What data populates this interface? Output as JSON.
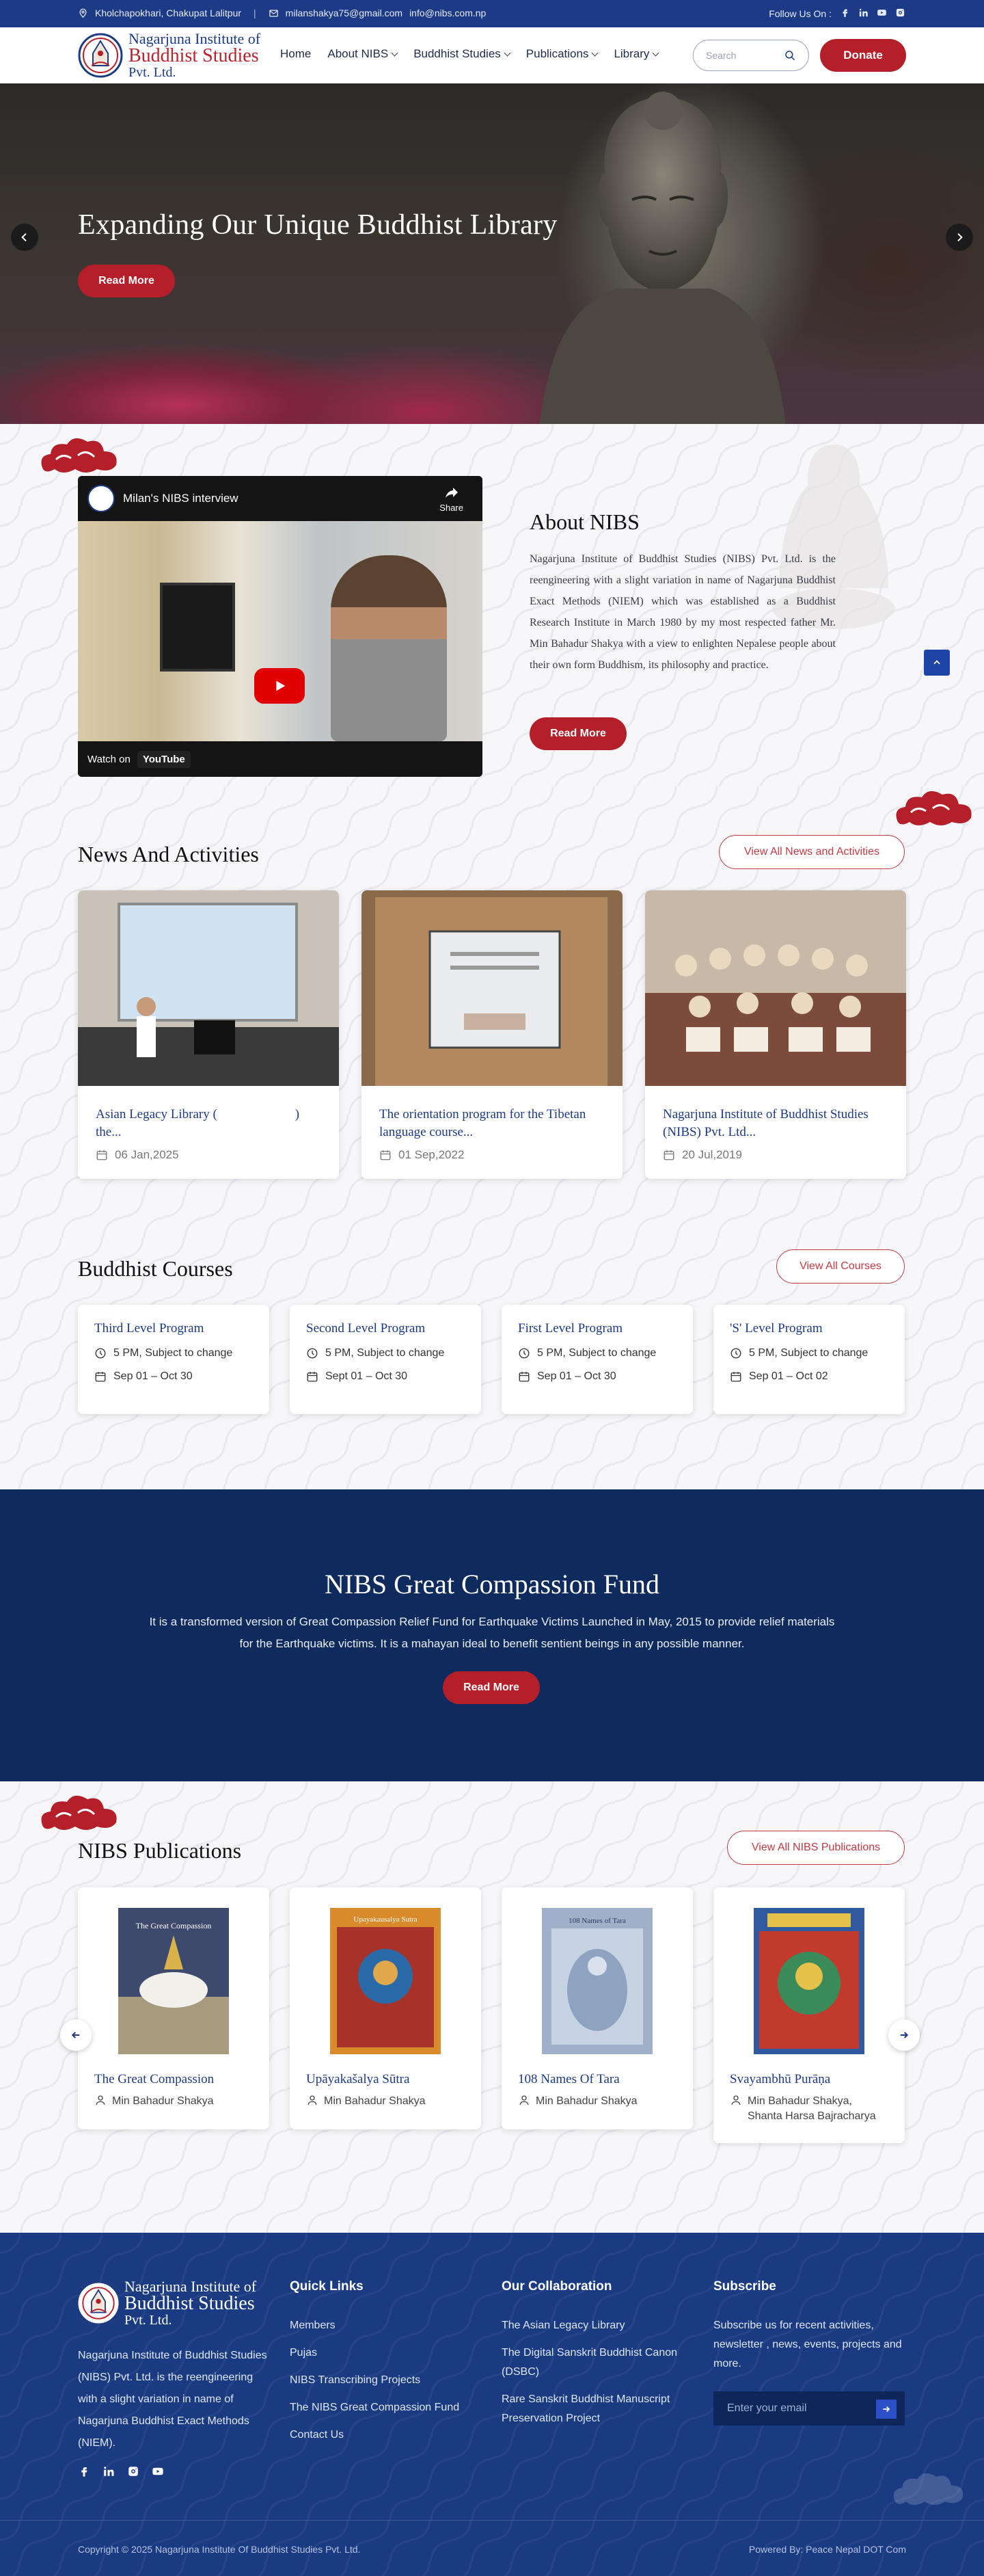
{
  "topbar": {
    "address": "Kholchapokhari, Chakupat Lalitpur",
    "email_1": "milanshakya75@gmail.com",
    "email_2": "info@nibs.com.np",
    "follow_label": "Follow Us On :"
  },
  "header": {
    "logo_line_1": "Nagarjuna Institute of",
    "logo_line_2": "Buddhist Studies",
    "logo_line_3": "Pvt. Ltd.",
    "nav": [
      "Home",
      "About NIBS",
      "Buddhist Studies",
      "Publications",
      "Library"
    ],
    "search_placeholder": "Search",
    "donate_label": "Donate"
  },
  "hero": {
    "title": "Expanding Our Unique Buddhist Library",
    "button": "Read More"
  },
  "about": {
    "video_title": "Milan's NIBS interview",
    "video_share": "Share",
    "video_watch_on": "Watch on",
    "video_platform": "YouTube",
    "heading": "About NIBS",
    "text": "Nagarjuna Institute of Buddhist Studies (NIBS) Pvt. Ltd. is the reengineering with a slight variation in name of Nagarjuna Buddhist Exact Methods (NIEM) which was established as a Buddhist Research Institute in March 1980 by my most respected father Mr. Min Bahadur Shakya with a view to enlighten Nepalese people about their own form Buddhism, its philosophy and practice.",
    "button": "Read More"
  },
  "news": {
    "heading": "News And Activities",
    "view_all": "View All News and Activities",
    "items": [
      {
        "title": "Asian Legacy Library (                        )    the...",
        "date": "06 Jan,2025"
      },
      {
        "title": "The orientation program for the Tibetan language course...",
        "date": "01 Sep,2022"
      },
      {
        "title": "Nagarjuna Institute of Buddhist Studies (NIBS) Pvt. Ltd...",
        "date": "20 Jul,2019"
      }
    ]
  },
  "courses": {
    "heading": "Buddhist Courses",
    "view_all": "View All Courses",
    "items": [
      {
        "title": "Third Level Program",
        "time": "5 PM, Subject to change",
        "dates": "Sep 01 – Oct 30"
      },
      {
        "title": "Second Level Program",
        "time": "5 PM, Subject to change",
        "dates": "Sept 01 – Oct 30"
      },
      {
        "title": "First Level Program",
        "time": "5 PM, Subject to change",
        "dates": "Sep 01 – Oct 30"
      },
      {
        "title": "'S' Level Program",
        "time": "5 PM, Subject to change",
        "dates": "Sep 01 – Oct 02"
      }
    ]
  },
  "fund": {
    "heading": "NIBS Great Compassion Fund",
    "text": "It is a transformed version of Great Compassion Relief Fund for Earthquake Victims Launched in May, 2015 to provide relief materials for the Earthquake victims. It is a mahayan ideal to benefit sentient beings in any possible manner.",
    "button": "Read More"
  },
  "publications": {
    "heading": "NIBS Publications",
    "view_all": "View All NIBS Publications",
    "items": [
      {
        "title": "The Great Compassion",
        "author": "Min Bahadur Shakya",
        "cover_text": "The Great Compassion"
      },
      {
        "title": "Upāyakašalya Sūtra",
        "author": "Min Bahadur Shakya",
        "cover_text": "Upayakausalya Sutra"
      },
      {
        "title": "108 Names Of Tara",
        "author": "Min Bahadur Shakya",
        "cover_text": "108 Names of Tara"
      },
      {
        "title": "Svayambhū Purāṇa",
        "author": "Min Bahadur Shakya, Shanta Harsa Bajracharya",
        "cover_text": ""
      }
    ]
  },
  "footer": {
    "description": "Nagarjuna Institute of Buddhist Studies (NIBS) Pvt. Ltd. is the reengineering with a slight variation in name of Nagarjuna Buddhist Exact Methods (NIEM).",
    "quick_links_heading": "Quick Links",
    "quick_links": [
      "Members",
      "Pujas",
      "NIBS Transcribing Projects",
      "The NIBS Great Compassion Fund",
      "Contact Us"
    ],
    "collab_heading": "Our Collaboration",
    "collab_links": [
      "The Asian Legacy Library",
      "The Digital Sanskrit Buddhist Canon (DSBC)",
      "Rare Sanskrit Buddhist Manuscript Preservation Project"
    ],
    "subscribe_heading": "Subscribe",
    "subscribe_text": "Subscribe us for recent activities, newsletter , news, events, projects and more.",
    "email_placeholder": "Enter your email",
    "copyright": "Copyright © 2025 Nagarjuna Institute Of Buddhist Studies Pvt. Ltd.",
    "powered": "Powered By: Peace Nepal DOT Com"
  },
  "colors": {
    "brand_blue": "#1c3a86",
    "brand_red": "#b51f2a",
    "fund_bg": "#0f2b5e"
  }
}
